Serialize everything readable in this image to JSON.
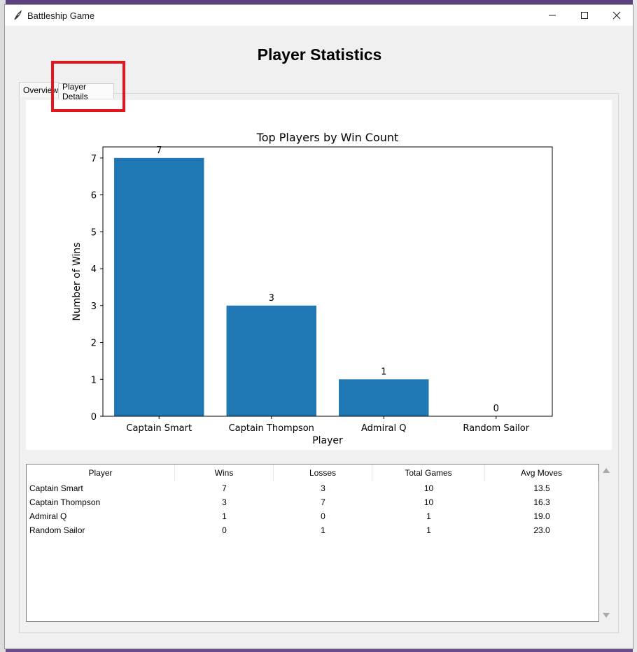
{
  "window": {
    "title": "Battleship Game",
    "controls": [
      "minimize",
      "maximize",
      "close"
    ]
  },
  "heading": "Player Statistics",
  "tabs": [
    {
      "label": "Overview"
    },
    {
      "label": "Player Details"
    }
  ],
  "colors": {
    "bar": "#1f77b4",
    "highlight": "#e8141c",
    "window_bg": "#f0f0f0"
  },
  "chart_data": {
    "type": "bar",
    "title": "Top Players by Win Count",
    "xlabel": "Player",
    "ylabel": "Number of Wins",
    "categories": [
      "Captain Smart",
      "Captain Thompson",
      "Admiral Q",
      "Random Sailor"
    ],
    "values": [
      7,
      3,
      1,
      0
    ],
    "data_labels": [
      "7",
      "3",
      "1",
      "0"
    ],
    "ylim": [
      0,
      7.3
    ],
    "yticks": [
      "0",
      "1",
      "2",
      "3",
      "4",
      "5",
      "6",
      "7"
    ],
    "grid": false
  },
  "table": {
    "columns": [
      "Player",
      "Wins",
      "Losses",
      "Total Games",
      "Avg Moves"
    ],
    "rows": [
      [
        "Captain Smart",
        "7",
        "3",
        "10",
        "13.5"
      ],
      [
        "Captain Thompson",
        "3",
        "7",
        "10",
        "16.3"
      ],
      [
        "Admiral Q",
        "1",
        "0",
        "1",
        "19.0"
      ],
      [
        "Random Sailor",
        "0",
        "1",
        "1",
        "23.0"
      ]
    ]
  }
}
